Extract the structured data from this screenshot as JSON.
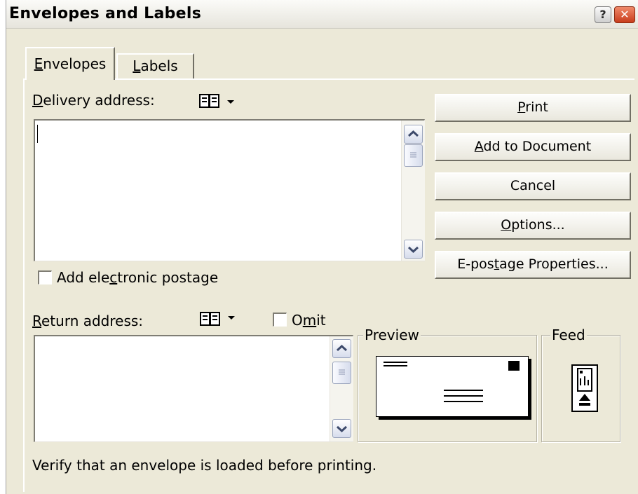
{
  "window": {
    "title": "Envelopes and Labels",
    "help_glyph": "?",
    "close_glyph": "✕"
  },
  "tabs": [
    {
      "label": "Envelopes",
      "mnemonic": "E",
      "rest": "nvelopes",
      "selected": true
    },
    {
      "label": "Labels",
      "mnemonic": "L",
      "rest": "abels",
      "selected": false
    }
  ],
  "delivery": {
    "label_pre": "",
    "label_mnemonic": "D",
    "label_post": "elivery address:",
    "value": "",
    "icon": "address-book-icon"
  },
  "electronic_postage": {
    "label_pre": "Add ele",
    "label_mnemonic": "c",
    "label_post": "tronic postage",
    "checked": false
  },
  "return": {
    "label_pre": "",
    "label_mnemonic": "R",
    "label_post": "eturn address:",
    "value": "",
    "icon": "address-book-icon"
  },
  "omit": {
    "label_pre": "O",
    "label_mnemonic": "m",
    "label_post": "it",
    "checked": false
  },
  "buttons": [
    {
      "name": "print-button",
      "pre": "",
      "mnemonic": "P",
      "post": "rint"
    },
    {
      "name": "add-to-document-button",
      "pre": "",
      "mnemonic": "A",
      "post": "dd to Document"
    },
    {
      "name": "cancel-button",
      "pre": "Cancel",
      "mnemonic": "",
      "post": ""
    },
    {
      "name": "options-button",
      "pre": "",
      "mnemonic": "O",
      "post": "ptions..."
    },
    {
      "name": "e-postage-properties-button",
      "pre": "E-pos",
      "mnemonic": "t",
      "post": "age Properties..."
    }
  ],
  "preview": {
    "title": "Preview"
  },
  "feed": {
    "title": "Feed"
  },
  "status_text": "Verify that an envelope is loaded before printing.",
  "icons": {
    "scroll_up": "chevron-up-icon",
    "scroll_down": "chevron-down-icon"
  }
}
